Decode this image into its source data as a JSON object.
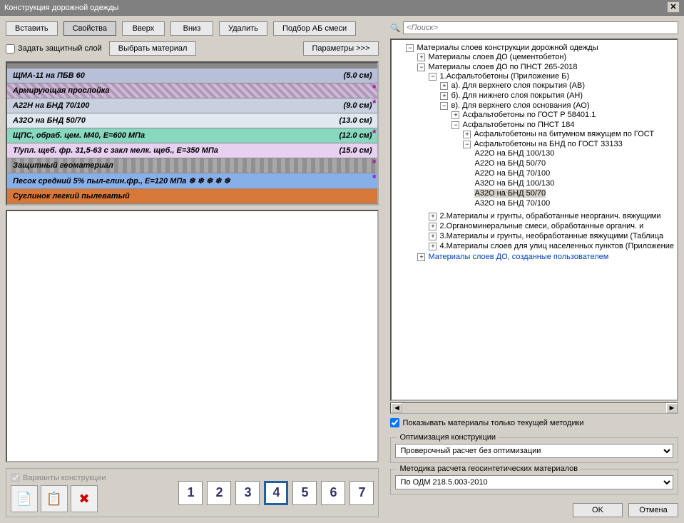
{
  "title": "Конструкция дорожной одежды",
  "toolbar": {
    "insert": "Вставить",
    "props": "Свойства",
    "up": "Вверх",
    "down": "Вниз",
    "delete": "Удалить",
    "mix": "Подбор АБ смеси"
  },
  "row2": {
    "protect": "Задать защитный слой",
    "choose": "Выбрать материал",
    "params": "Параметры >>>"
  },
  "layers": [
    {
      "name": "ЩМА-11 на ПБВ 60",
      "thk": "(5.0 см)",
      "cls": "l1",
      "star": false
    },
    {
      "name": "Армирующая прослойка",
      "thk": "",
      "cls": "l2",
      "star": true
    },
    {
      "name": "А22Н на БНД 70/100",
      "thk": "(9.0 см)",
      "cls": "l3",
      "star": true
    },
    {
      "name": "А32О на БНД 50/70",
      "thk": "(13.0 см)",
      "cls": "l4",
      "star": false
    },
    {
      "name": "ЩПС, обраб. цем. М40, Е=600 МПа",
      "thk": "(12.0 см)",
      "cls": "l5",
      "star": true
    },
    {
      "name": "Т/упл. щеб. фр. 31,5-63 с закл мелк. щеб., Е=350 МПа",
      "thk": "(15.0 см)",
      "cls": "l6",
      "star": false
    },
    {
      "name": "Защитный геоматериал",
      "thk": "",
      "cls": "l7",
      "star": true
    },
    {
      "name": "Песок средний 5% пыл-глин.фр., Е=120 МПа  ❄ ❄ ❄ ❄ ❄",
      "thk": "",
      "cls": "l8",
      "star": true
    },
    {
      "name": "Суглинок легкий пылеватый",
      "thk": "",
      "cls": "l9",
      "star": false
    }
  ],
  "variants_label": "Варианты конструкции",
  "nums": [
    "1",
    "2",
    "3",
    "4",
    "5",
    "6",
    "7"
  ],
  "active_num": 3,
  "search_placeholder": "<Поиск>",
  "tree_root": "Материалы слоев конструкции дорожной одежды",
  "tree": {
    "n1": "Материалы слоев ДО (цементобетон)",
    "n2": "Материалы слоев ДО по ПНСТ 265-2018",
    "n3": "1.Асфальтобетоны (Приложение Б)",
    "n4": "а). Для верхнего слоя покрытия (АВ)",
    "n5": "б). Для нижнего слоя покрытия (АН)",
    "n6": "в). Для верхнего слоя основания (АО)",
    "n7": "Асфальтобетоны по ГОСТ Р 58401.1",
    "n8": "Асфальтобетоны по ПНСТ 184",
    "n9": "Асфальтобетоны на битумном вяжущем по ГОСТ",
    "n10": "Асфальтобетоны на БНД по ГОСТ 33133",
    "n11": "А22О на БНД 100/130",
    "n12": "А22О на БНД 50/70",
    "n13": "А22О на БНД 70/100",
    "n14": "А32О на БНД 100/130",
    "n15": "А32О на БНД 50/70",
    "n16": "А32О на БНД 70/100",
    "n17": "2.Материалы и грунты, обработанные неорганич. вяжущими",
    "n18": "2.Органоминеральные смеси, обработанные органич. и",
    "n19": "3.Материалы и грунты, необработанные вяжущими (Таблица",
    "n20": "4.Материалы слоев для улиц населенных пунктов (Приложение",
    "n21": "Материалы слоев ДО, созданные пользователем"
  },
  "show_current": "Показывать материалы только текущей методики",
  "opt_label": "Оптимизация конструкции",
  "opt_value": "Проверочный расчет без оптимизации",
  "geo_label": "Методика расчета геосинтетических материалов",
  "geo_value": "По ОДМ 218.5.003-2010",
  "ok": "OK",
  "cancel": "Отмена"
}
